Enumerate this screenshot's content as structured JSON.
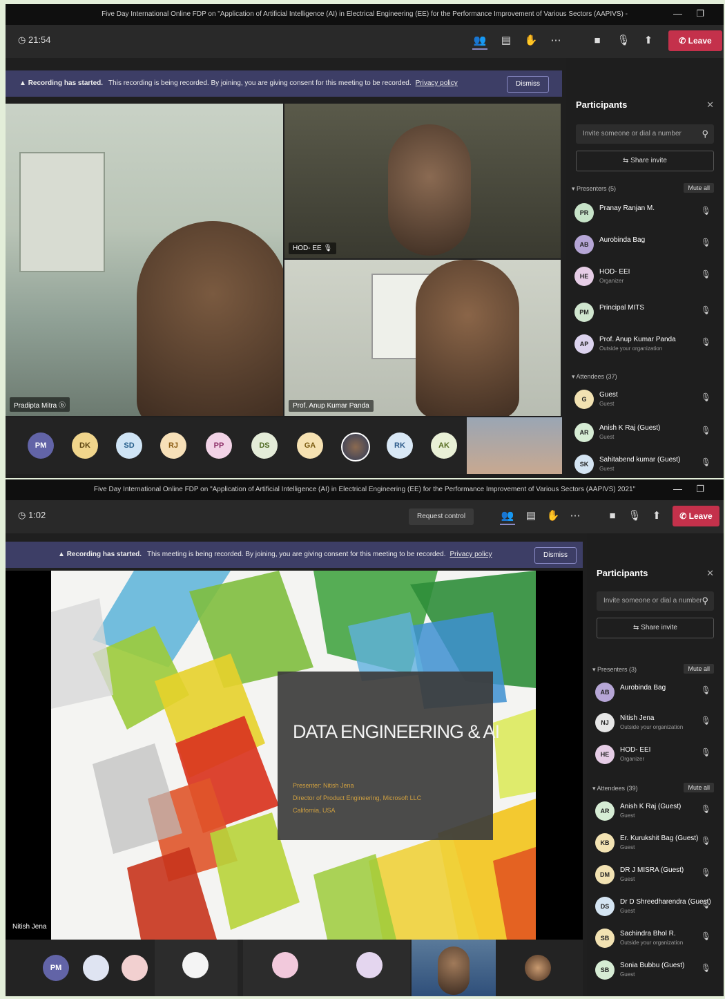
{
  "top": {
    "window_title": "Five Day International Online FDP on \"Application of Artificial Intelligence (AI) in Electrical Engineering (EE) for the Performance Improvement of Various Sectors (AAPIVS) -",
    "timer": "21:54",
    "recording": {
      "bold": "Recording has started.",
      "text": "This recording is being recorded. By joining, you are giving consent for this meeting to be recorded.",
      "link": "Privacy policy",
      "dismiss": "Dismiss"
    },
    "leave_label": "Leave",
    "tiles": [
      {
        "name": "Pradipta Mitra ⓑ"
      },
      {
        "name": "HOD- EE"
      },
      {
        "name": "Prof. Anup Kumar Panda"
      }
    ],
    "avatars": [
      "PM",
      "DK",
      "SD",
      "RJ",
      "PP",
      "DS",
      "GA",
      "",
      "RK",
      "AK"
    ],
    "panel": {
      "title": "Participants",
      "invite_placeholder": "Invite someone or dial a number",
      "share_invite": "Share invite",
      "presenters_label": "Presenters (5)",
      "mute_all": "Mute all",
      "presenters": [
        {
          "initials": "PR",
          "name": "Pranay Ranjan M.",
          "sub": ""
        },
        {
          "initials": "AB",
          "name": "Aurobinda Bag",
          "sub": ""
        },
        {
          "initials": "HE",
          "name": "HOD- EEI",
          "sub": "Organizer"
        },
        {
          "initials": "PM",
          "name": "Principal MITS",
          "sub": ""
        },
        {
          "initials": "AP",
          "name": "Prof. Anup Kumar Panda",
          "sub": "Outside your organization"
        }
      ],
      "attendees_label": "Attendees (37)",
      "attendees": [
        {
          "initials": "G",
          "name": "Guest",
          "sub": "Guest"
        },
        {
          "initials": "AR",
          "name": "Anish K Raj (Guest)",
          "sub": "Guest"
        },
        {
          "initials": "SK",
          "name": "Sahitabend kumar (Guest)",
          "sub": "Guest"
        }
      ]
    }
  },
  "bottom": {
    "window_title": "Five Day International Online FDP on \"Application of Artificial Intelligence (AI) in Electrical Engineering (EE) for the Performance Improvement of Various Sectors (AAPIVS) 2021\"",
    "timer": "1:02",
    "request_control": "Request control",
    "leave_label": "Leave",
    "recording": {
      "bold": "Recording has started.",
      "text": "This meeting is being recorded. By joining, you are giving consent for this meeting to be recorded.",
      "link": "Privacy policy",
      "dismiss": "Dismiss"
    },
    "slide": {
      "title": "DATA ENGINEERING & AI",
      "lines": [
        "Presenter: Nitish Jena",
        "Director of Product Engineering, Microsoft LLC",
        "California, USA"
      ]
    },
    "presenter_chip": "Nitish Jena",
    "avatars": [
      "PM",
      "",
      "",
      "",
      "",
      ""
    ],
    "avatar_labels": [
      "",
      "",
      "",
      "",
      "",
      ""
    ],
    "panel": {
      "title": "Participants",
      "invite_placeholder": "Invite someone or dial a number",
      "share_invite": "Share invite",
      "presenters_label": "Presenters (3)",
      "mute_all": "Mute all",
      "presenters": [
        {
          "initials": "AB",
          "name": "Aurobinda Bag",
          "sub": ""
        },
        {
          "initials": "NJ",
          "name": "Nitish Jena",
          "sub": "Outside your organization"
        },
        {
          "initials": "HE",
          "name": "HOD- EEI",
          "sub": "Organizer"
        }
      ],
      "attendees_label": "Attendees (39)",
      "attendees": [
        {
          "initials": "AR",
          "name": "Anish K Raj (Guest)",
          "sub": "Guest"
        },
        {
          "initials": "KB",
          "name": "Er. Kurukshit Bag (Guest)",
          "sub": "Guest"
        },
        {
          "initials": "DM",
          "name": "DR J MISRA (Guest)",
          "sub": "Guest"
        },
        {
          "initials": "DS",
          "name": "Dr D Shreedharendra (Guest)",
          "sub": "Guest"
        },
        {
          "initials": "SB",
          "name": "Sachindra Bhol R.",
          "sub": "Outside your organization"
        },
        {
          "initials": "SB",
          "name": "Sonia Bubbu (Guest)",
          "sub": "Guest"
        }
      ]
    }
  },
  "colors": {
    "leave": "#c4314b",
    "recbar": "#3d3e66",
    "panel": "#1e1e1e",
    "frame": "#e3eed9"
  }
}
